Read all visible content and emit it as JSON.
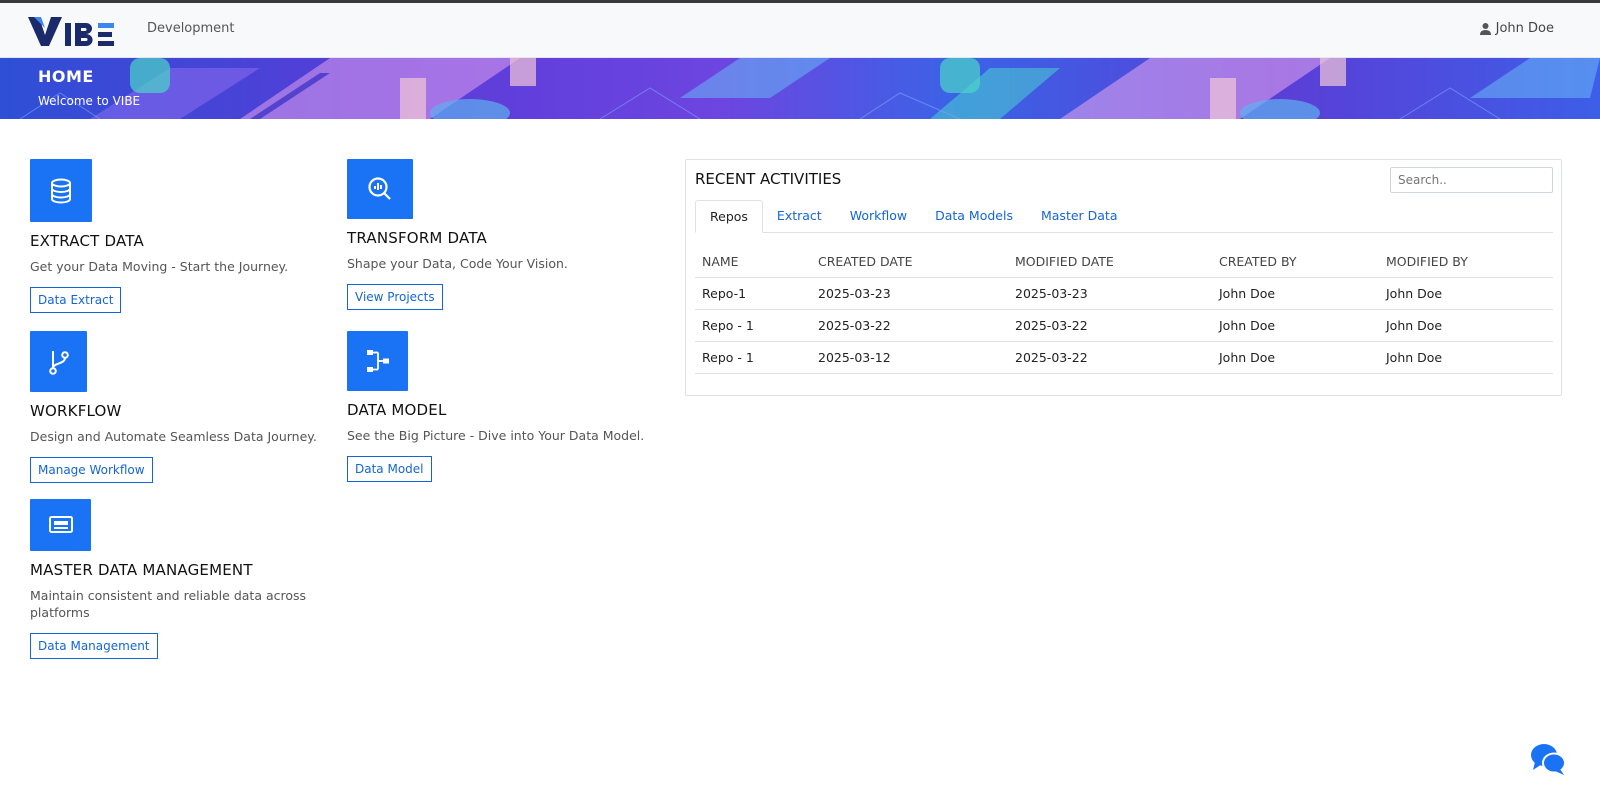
{
  "header": {
    "logo_text": "VIBE",
    "environment": "Development",
    "user_name": "John Doe"
  },
  "banner": {
    "title": "HOME",
    "subtitle": "Welcome to VIBE"
  },
  "cards": {
    "extract": {
      "title": "EXTRACT DATA",
      "desc": "Get your Data Moving - Start the Journey.",
      "button": "Data Extract"
    },
    "transform": {
      "title": "TRANSFORM DATA",
      "desc": "Shape your Data, Code Your Vision.",
      "button": "View Projects"
    },
    "workflow": {
      "title": "WORKFLOW",
      "desc": "Design and Automate Seamless Data Journey.",
      "button": "Manage Workflow"
    },
    "data_model": {
      "title": "DATA MODEL",
      "desc": "See the Big Picture - Dive into Your Data Model.",
      "button": "Data Model"
    },
    "master_data": {
      "title": "MASTER DATA MANAGEMENT",
      "desc": "Maintain consistent and reliable data across platforms",
      "button": "Data Management"
    }
  },
  "activities": {
    "title": "RECENT ACTIVITIES",
    "search_placeholder": "Search..",
    "tabs": [
      "Repos",
      "Extract",
      "Workflow",
      "Data Models",
      "Master Data"
    ],
    "active_tab": "Repos",
    "columns": [
      "NAME",
      "CREATED DATE",
      "MODIFIED DATE",
      "CREATED BY",
      "MODIFIED BY"
    ],
    "rows": [
      [
        "Repo-1",
        "2025-03-23",
        "2025-03-23",
        "John Doe",
        "John Doe"
      ],
      [
        "Repo - 1",
        "2025-03-22",
        "2025-03-22",
        "John Doe",
        "John Doe"
      ],
      [
        "Repo - 1",
        "2025-03-12",
        "2025-03-22",
        "John Doe",
        "John Doe"
      ]
    ]
  },
  "colors": {
    "accent": "#1a73f5",
    "link": "#1565d8",
    "navbar_bg": "#f8f9fa"
  },
  "icons": {
    "extract": "database-icon",
    "transform": "search-chart-icon",
    "workflow": "git-branch-icon",
    "data_model": "hierarchy-icon",
    "master_data": "card-icon",
    "user": "user-icon",
    "chat": "chat-bubbles-icon"
  }
}
